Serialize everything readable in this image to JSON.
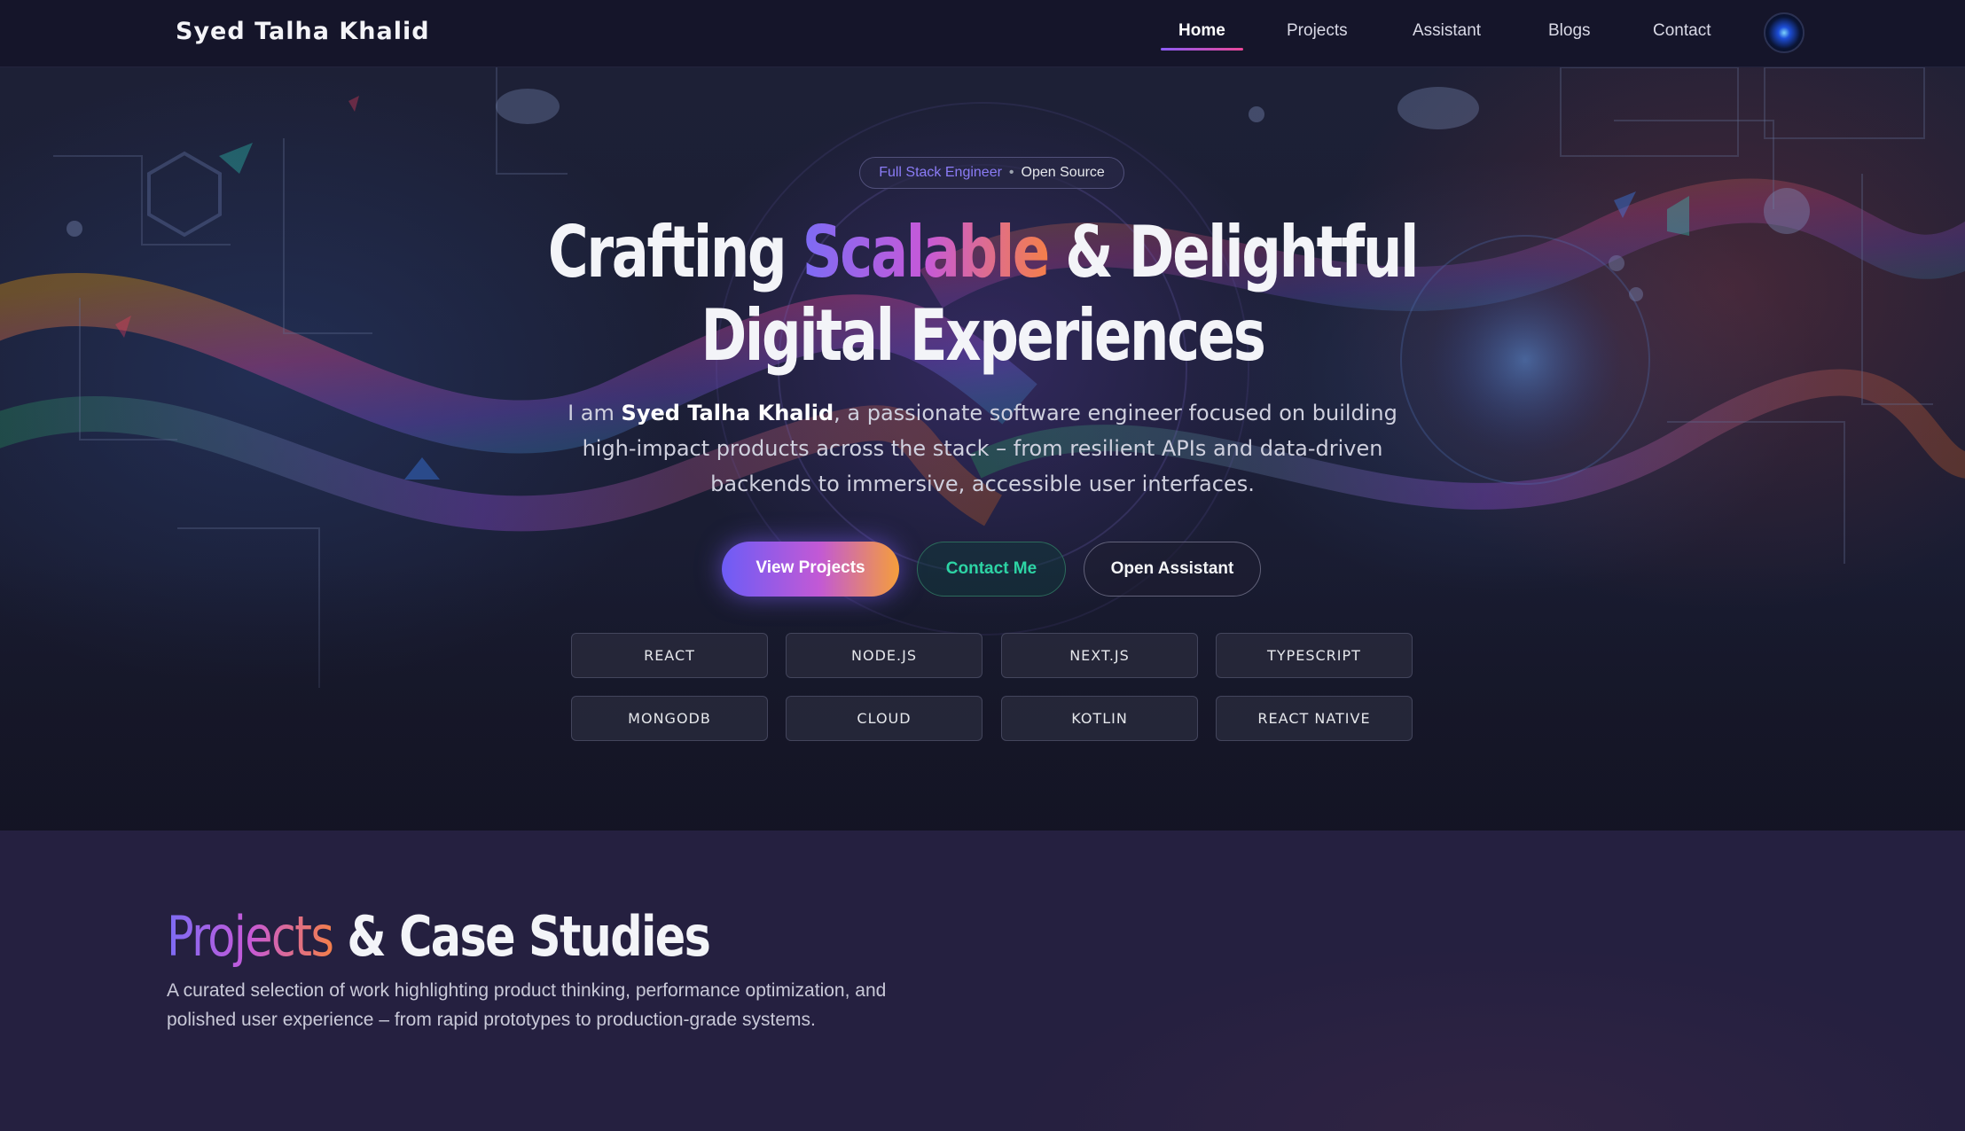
{
  "nav": {
    "brand": "Syed Talha Khalid",
    "links": [
      {
        "label": "Home",
        "active": true
      },
      {
        "label": "Projects",
        "active": false
      },
      {
        "label": "Assistant",
        "active": false
      },
      {
        "label": "Blogs",
        "active": false
      },
      {
        "label": "Contact",
        "active": false
      }
    ],
    "avatar_icon": "globe-avatar-icon"
  },
  "hero": {
    "badge": {
      "primary": "Full Stack Engineer",
      "separator": "•",
      "secondary": "Open Source"
    },
    "headline": {
      "part1": "Crafting",
      "highlight": "Scalable",
      "part2": "& Delightful",
      "line2": "Digital Experiences"
    },
    "intro": {
      "prefix": "I am",
      "name": "Syed Talha Khalid",
      "rest": ", a passionate software engineer focused on building high-impact products across the stack – from resilient APIs and data-driven backends to immersive, accessible user interfaces."
    },
    "buttons": {
      "primary": "View Projects",
      "contact": "Contact Me",
      "assistant": "Open Assistant"
    },
    "skills": [
      "REACT",
      "NODE.JS",
      "NEXT.JS",
      "TYPESCRIPT",
      "MONGODB",
      "CLOUD",
      "KOTLIN",
      "REACT NATIVE"
    ]
  },
  "projects": {
    "title_highlight": "Projects",
    "title_rest": "& Case Studies",
    "description": "A curated selection of work highlighting product thinking, performance optimization, and polished user experience – from rapid prototypes to production-grade systems."
  },
  "colors": {
    "accent_purple": "#7c6cf5",
    "accent_pink": "#c659d8",
    "accent_orange": "#f47f4a",
    "contact_green": "#2dd4a4",
    "nav_bg": "#15152a",
    "section_bg": "#252040"
  }
}
